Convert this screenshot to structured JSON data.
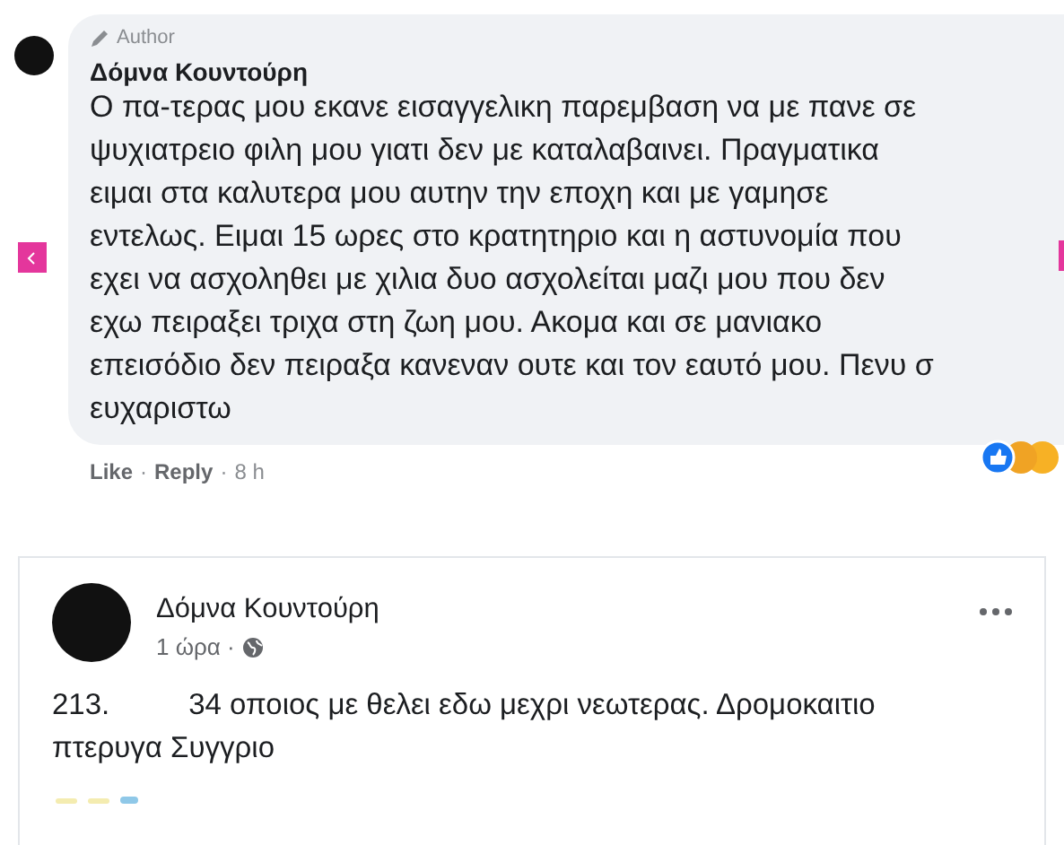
{
  "comment": {
    "badge": "Author",
    "author": "Δόμνα Κουντούρη",
    "text": "Ο πα-τερας μου εκανε εισαγγελικη παρεμβαση να με πανε σε\nψυχιατρειο φιλη μου γιατι δεν με καταλαβαινει. Πραγματικα\nειμαι στα καλυτερα μου αυτην την εποχη και με γαμησε\nεντελως. Ειμαι 15 ωρες στο κρατητηριο και η αστυνομία που\nεχει να ασχοληθει με χιλια δυο ασχολείται μαζι μου που δεν\nεχω πειραξει τριχα στη ζωη μου. Ακομα και σε μανιακο\nεπεισόδιο δεν πειραξα κανεναν ουτε και τον εαυτό μου. Πενυ σ\nευχαριστω",
    "actions": [
      {
        "label": "Like",
        "separator": "·"
      },
      {
        "label": "Reply",
        "separator": "·"
      }
    ],
    "time": "8 h"
  },
  "post": {
    "author": "Δόμνα Κουντούρη",
    "time": "1 ώρα ·",
    "number": "213.",
    "text": "34 οποιος με θελει εδω μεχρι νεωτερας. Δρομοκαιτιο πτερυγα Συγγριο"
  }
}
